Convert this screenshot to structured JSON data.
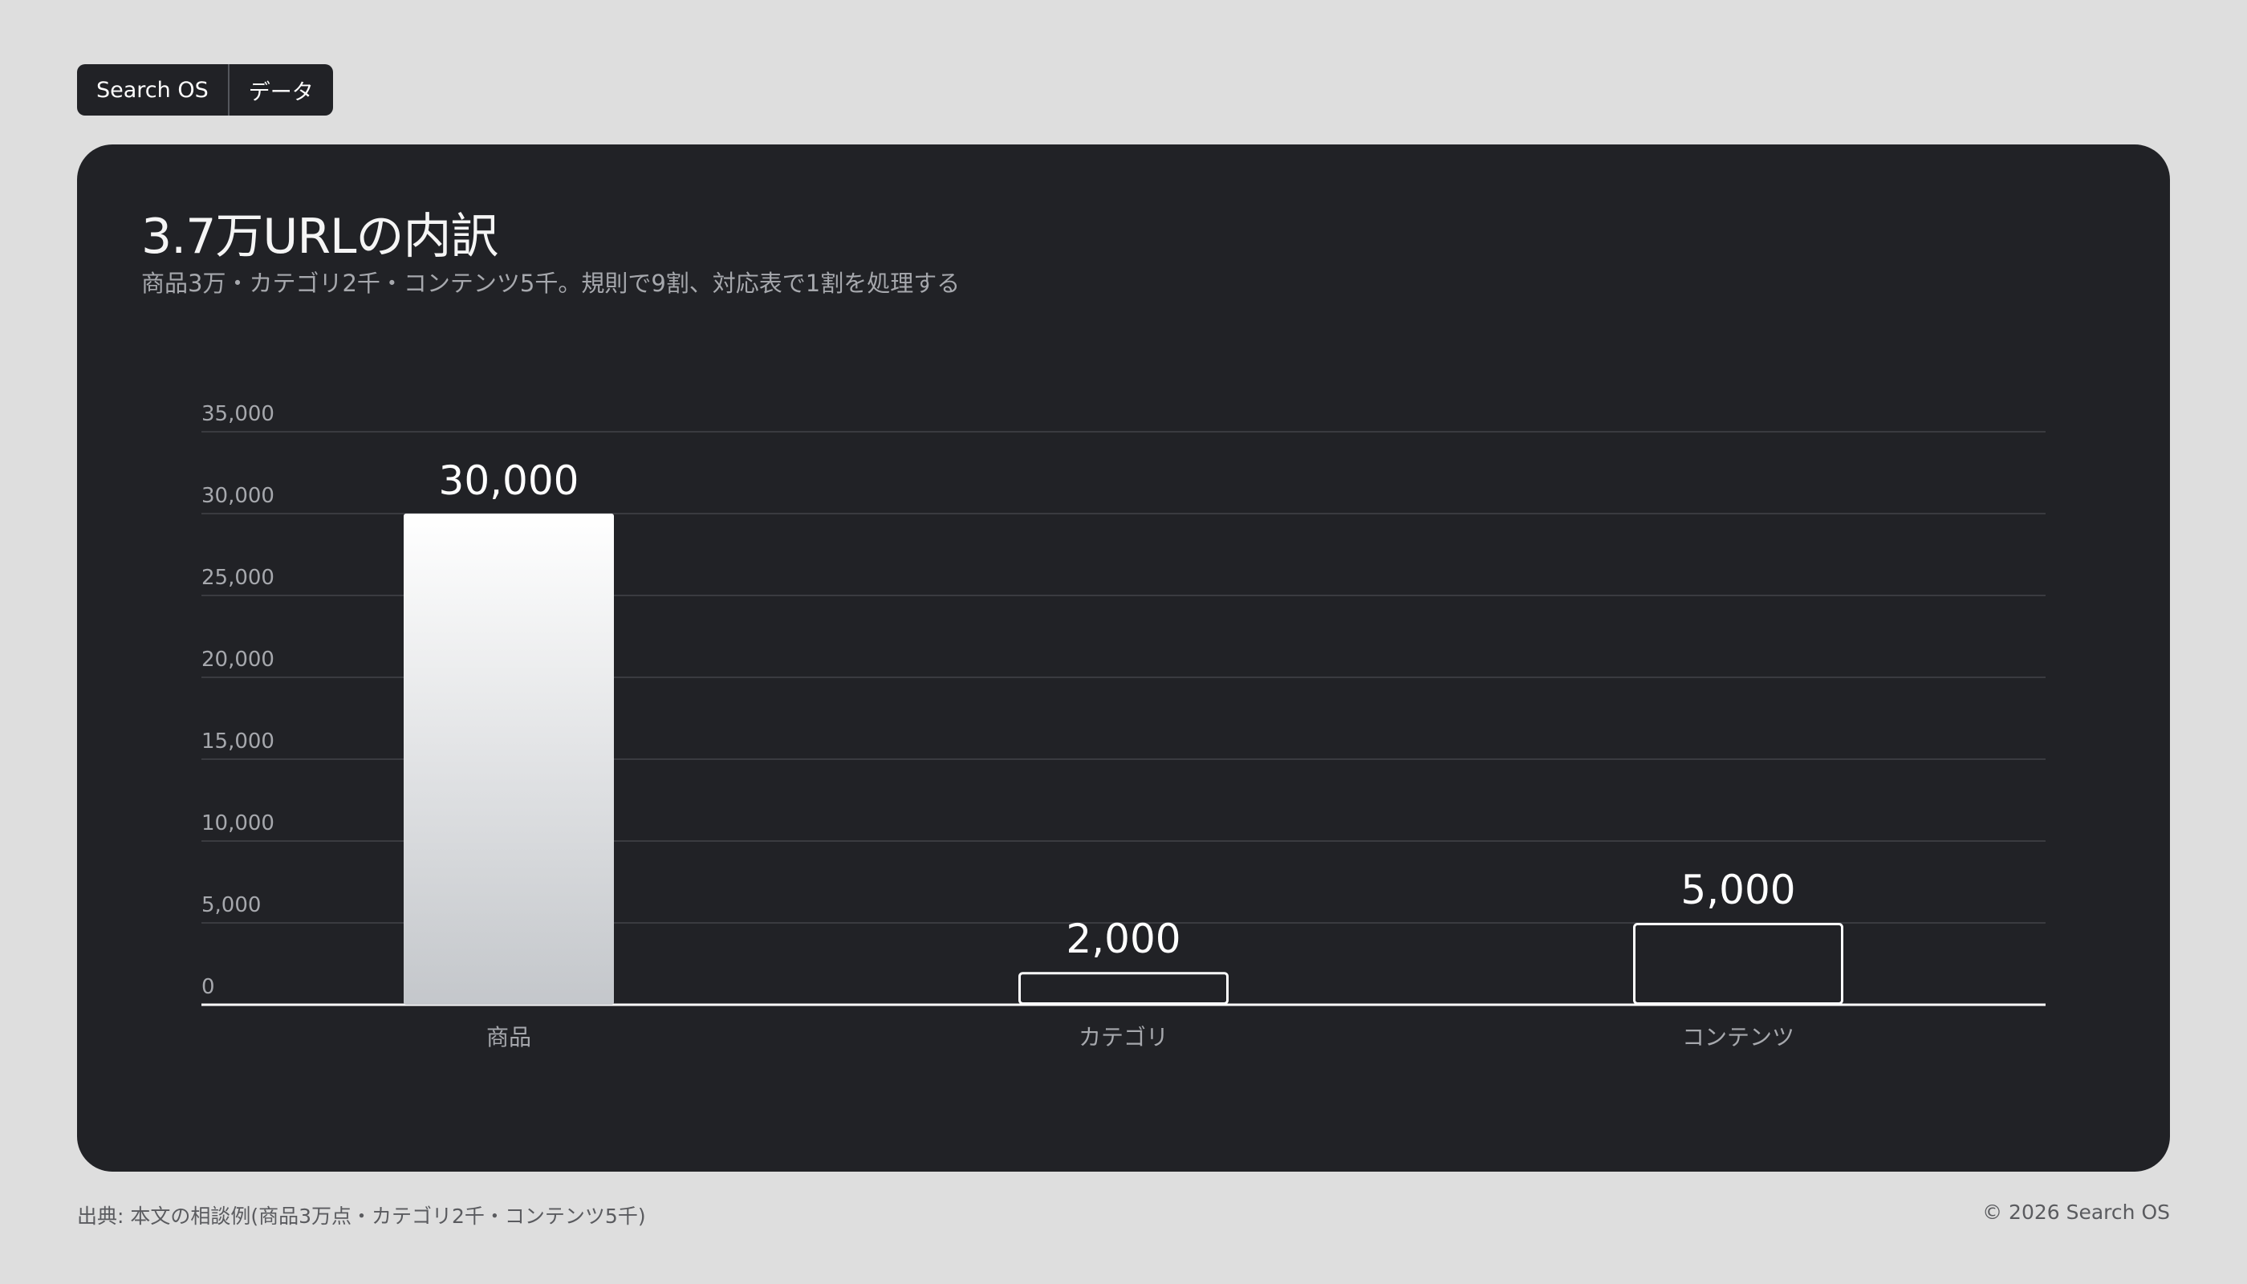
{
  "badge": {
    "brand": "Search OS",
    "section": "データ"
  },
  "colors": {
    "background": "#dedede",
    "card": "#212226",
    "bar_top": "#ffffff",
    "bar_bottom": "#c4c7cb",
    "outline": "#ffffff"
  },
  "chart_data": {
    "type": "bar",
    "title": "3.7万URLの内訳",
    "subtitle": "商品3万・カテゴリ2千・コンテンツ5千。規則で9割、対応表で1割を処理する",
    "xlabel": "",
    "ylabel": "",
    "categories": [
      "商品",
      "カテゴリ",
      "コンテンツ"
    ],
    "values": [
      30000,
      2000,
      5000
    ],
    "value_labels": [
      "30,000",
      "2,000",
      "5,000"
    ],
    "styles": [
      "filled",
      "outline",
      "outline"
    ],
    "ylim": [
      0,
      35000
    ],
    "yticks": [
      0,
      5000,
      10000,
      15000,
      20000,
      25000,
      30000,
      35000
    ],
    "ytick_labels": [
      "0",
      "5,000",
      "10,000",
      "15,000",
      "20,000",
      "25,000",
      "30,000",
      "35,000"
    ],
    "grid": true,
    "legend": "none"
  },
  "footer": {
    "source": "出典: 本文の相談例(商品3万点・カテゴリ2千・コンテンツ5千)",
    "copyright": "© 2026 Search OS"
  }
}
